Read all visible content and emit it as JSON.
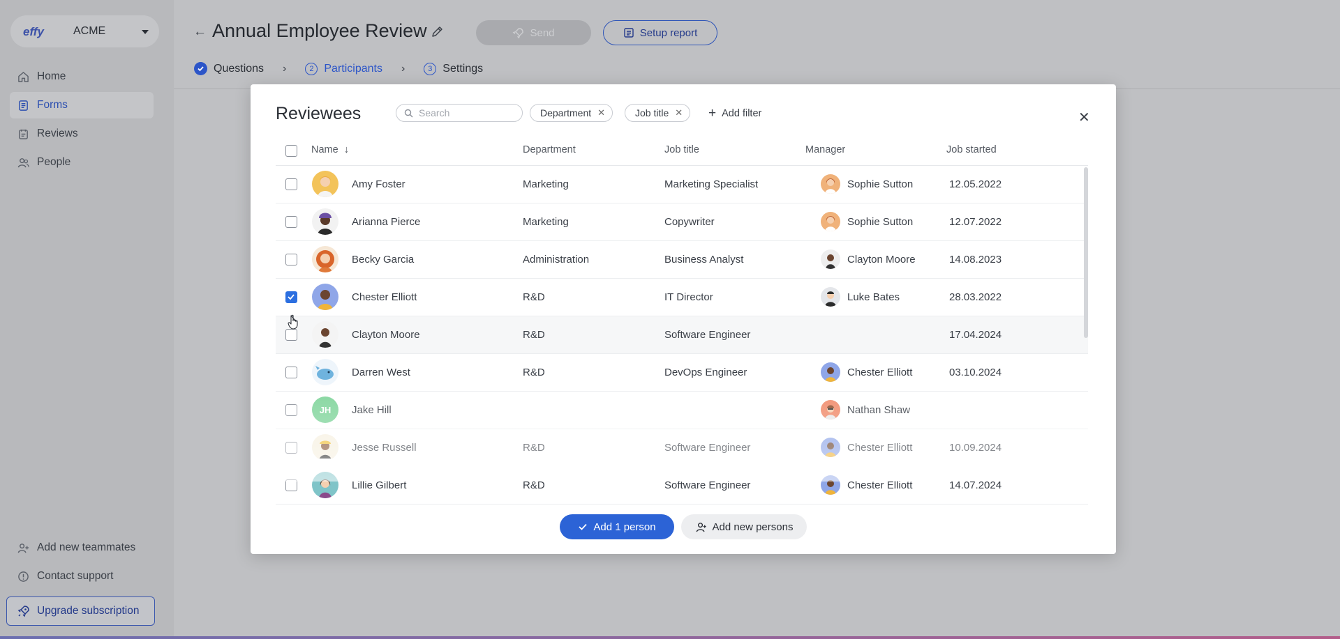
{
  "sidebar": {
    "org_logo": "effy",
    "org_name": "ACME",
    "nav": [
      {
        "label": "Home",
        "icon": "home-icon"
      },
      {
        "label": "Forms",
        "icon": "forms-icon",
        "active": true
      },
      {
        "label": "Reviews",
        "icon": "reviews-icon"
      },
      {
        "label": "People",
        "icon": "people-icon"
      }
    ],
    "bottom": [
      {
        "label": "Add new teammates",
        "icon": "add-user-icon"
      },
      {
        "label": "Contact support",
        "icon": "support-icon"
      }
    ],
    "upgrade_label": "Upgrade subscription"
  },
  "header": {
    "title": "Annual Employee Review",
    "send_label": "Send",
    "setup_label": "Setup report",
    "steps": [
      {
        "label": "Questions",
        "num": "",
        "state": "done"
      },
      {
        "label": "Participants",
        "num": "2",
        "state": "current"
      },
      {
        "label": "Settings",
        "num": "3",
        "state": "todo"
      }
    ]
  },
  "modal": {
    "title": "Reviewees",
    "search_placeholder": "Search",
    "filters": [
      "Department",
      "Job title"
    ],
    "add_filter_label": "Add filter",
    "columns": {
      "name": "Name",
      "department": "Department",
      "job_title": "Job title",
      "manager": "Manager",
      "job_started": "Job started"
    },
    "rows": [
      {
        "name": "Amy Foster",
        "department": "Marketing",
        "job_title": "Marketing Specialist",
        "manager": "Sophie Sutton",
        "job_started": "12.05.2022",
        "checked": false,
        "avatar_color": "#f3c35a",
        "manager_color": "#f0b27a"
      },
      {
        "name": "Arianna Pierce",
        "department": "Marketing",
        "job_title": "Copywriter",
        "manager": "Sophie Sutton",
        "job_started": "12.07.2022",
        "checked": false,
        "avatar_color": "#6b4fa3",
        "manager_color": "#f0b27a"
      },
      {
        "name": "Becky Garcia",
        "department": "Administration",
        "job_title": "Business Analyst",
        "manager": "Clayton Moore",
        "job_started": "14.08.2023",
        "checked": false,
        "avatar_color": "#e07a3a",
        "manager_color": "#eeeeee"
      },
      {
        "name": "Chester Elliott",
        "department": "R&D",
        "job_title": "IT Director",
        "manager": "Luke Bates",
        "job_started": "28.03.2022",
        "checked": true,
        "avatar_color": "#8fa6e8",
        "manager_color": "#e4e6ea"
      },
      {
        "name": "Clayton Moore",
        "department": "R&D",
        "job_title": "Software Engineer",
        "manager": "",
        "job_started": "17.04.2024",
        "checked": false,
        "avatar_color": "#eeeeee",
        "manager_color": ""
      },
      {
        "name": "Darren West",
        "department": "R&D",
        "job_title": "DevOps Engineer",
        "manager": "Chester Elliott",
        "job_started": "03.10.2024",
        "checked": false,
        "avatar_color": "#8ec5e8",
        "manager_color": "#8fa6e8"
      },
      {
        "name": "Jake Hill",
        "department": "",
        "job_title": "",
        "manager": "Nathan Shaw",
        "job_started": "",
        "checked": false,
        "initials": "JH",
        "avatar_color": "#7fd49a",
        "manager_color": "#f08a6a"
      },
      {
        "name": "Jesse Russell",
        "department": "R&D",
        "job_title": "Software Engineer",
        "manager": "Chester Elliott",
        "job_started": "10.09.2024",
        "checked": false,
        "avatar_color": "#f0d078",
        "manager_color": "#8fa6e8"
      },
      {
        "name": "Lillie Gilbert",
        "department": "R&D",
        "job_title": "Software Engineer",
        "manager": "Chester Elliott",
        "job_started": "14.07.2024",
        "checked": false,
        "avatar_color": "#7fc4c8",
        "manager_color": "#8fa6e8"
      }
    ],
    "add_person_label": "Add 1 person",
    "add_new_label": "Add new persons"
  }
}
